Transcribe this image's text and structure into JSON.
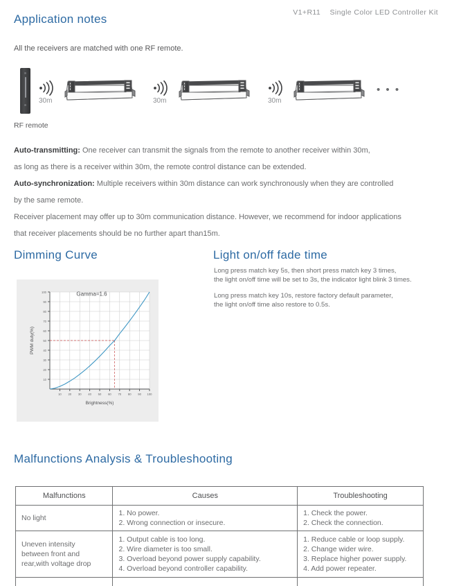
{
  "header": {
    "model": "V1+R11",
    "product": "Single Color LED Controller Kit"
  },
  "sections": {
    "application_notes": {
      "heading": "Application notes",
      "intro": "All the receivers are matched with one RF remote.",
      "diagram": {
        "remote_label": "RF remote",
        "distances": [
          "30m",
          "30m",
          "30m"
        ],
        "ellipsis": "• • •",
        "wave_icon": "rf-signal-icon",
        "device_icon": "led-controller-icon"
      },
      "paragraphs": [
        {
          "lead": "Auto-transmitting:",
          "text": " One receiver can transmit the signals from the remote to another receiver within 30m,"
        },
        {
          "lead": "",
          "text": "as long as there is a receiver within 30m, the remote control distance can be extended."
        },
        {
          "lead": "Auto-synchronization:",
          "text": " Multiple receivers within 30m distance can work synchronously when they are controlled"
        },
        {
          "lead": "",
          "text": "by the same remote."
        },
        {
          "lead": "",
          "text": "Receiver placement may offer up to 30m communication distance. However, we recommend for indoor applications"
        },
        {
          "lead": "",
          "text": "that receiver placements should be no further apart than15m."
        }
      ]
    },
    "dimming_curve": {
      "heading": "Dimming Curve"
    },
    "fade_time": {
      "heading": "Light on/off fade time",
      "paragraphs": [
        "Long press match key 5s, then short press match key 3 times,\nthe light on/off time will be set to 3s, the indicator light blink 3 times.",
        "Long press match key 10s, restore factory default parameter,\nthe light on/off time also restore to 0.5s."
      ]
    },
    "malfunctions": {
      "heading": "Malfunctions Analysis & Troubleshooting",
      "columns": [
        "Malfunctions",
        "Causes",
        "Troubleshooting"
      ],
      "rows": [
        {
          "malfunction": "No light",
          "causes": [
            "1. No power.",
            "2. Wrong connection or insecure."
          ],
          "troubleshooting": [
            "1. Check the power.",
            "2. Check the connection."
          ]
        },
        {
          "malfunction": "Uneven intensity\nbetween front and\nrear,with voltage drop",
          "causes": [
            "1. Output cable is too long.",
            "2. Wire diameter is too small.",
            "3. Overload beyond power supply capability.",
            "4. Overload beyond controller capability."
          ],
          "troubleshooting": [
            "1. Reduce cable or loop supply.",
            "2. Change wider wire.",
            "3. Replace higher power supply.",
            "4. Add power repeater."
          ]
        }
      ]
    }
  },
  "chart_data": {
    "type": "line",
    "title": "Gamma=1.6",
    "xlabel": "Brightness(%)",
    "ylabel": "PWM duty(%)",
    "xlim": [
      0,
      100
    ],
    "ylim": [
      0,
      100
    ],
    "xticks": [
      10,
      20,
      30,
      40,
      50,
      60,
      70,
      80,
      90,
      100
    ],
    "yticks": [
      10,
      20,
      30,
      40,
      50,
      60,
      70,
      80,
      90,
      100
    ],
    "grid": true,
    "line_color": "#3f97c4",
    "marker_color": "#c84a4a",
    "x": [
      0,
      5,
      10,
      15,
      20,
      25,
      30,
      35,
      40,
      45,
      50,
      55,
      60,
      65,
      70,
      75,
      80,
      85,
      90,
      95,
      100
    ],
    "y": [
      0,
      0.9,
      2.7,
      5.1,
      8.1,
      11.4,
      15.2,
      19.3,
      23.8,
      28.6,
      33.7,
      39.1,
      44.8,
      50.0,
      57.0,
      63.5,
      70.2,
      77.2,
      84.4,
      91.8,
      100
    ],
    "annotations": [
      {
        "label": "Gamma=1.6",
        "x": 42,
        "y": 96
      },
      {
        "label": "guide-line",
        "x": 65,
        "y": 50,
        "style": "dashed",
        "color": "#c84a4a"
      }
    ],
    "legend": null
  }
}
